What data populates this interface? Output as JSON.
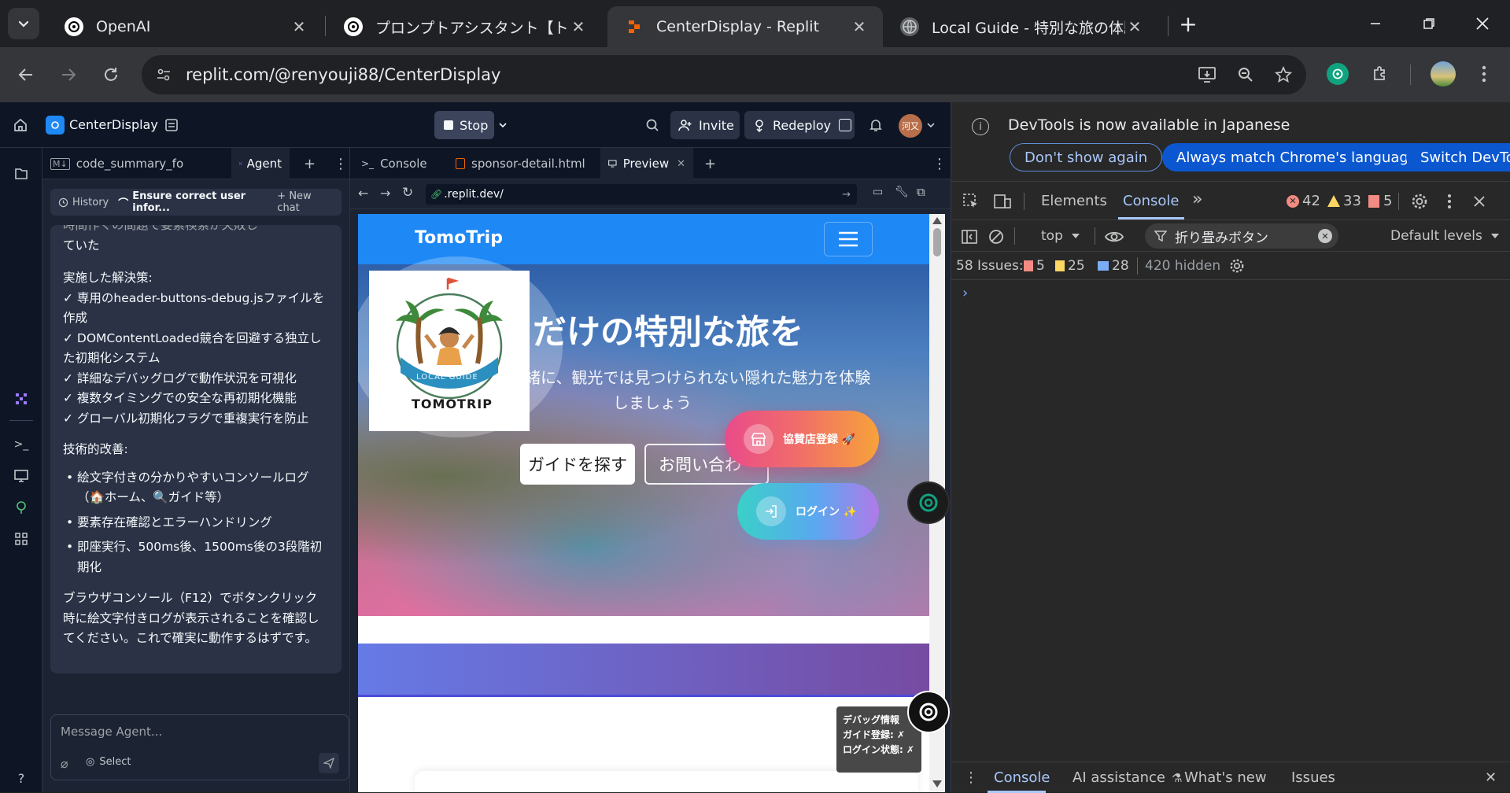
{
  "browser": {
    "tabs": [
      {
        "title": "OpenAI"
      },
      {
        "title": "プロンプトアシスタント【トゥモロープル-"
      },
      {
        "title": "CenterDisplay - Replit"
      },
      {
        "title": "Local Guide - 特別な旅の体験を"
      }
    ],
    "address": "replit.com/@renyouji88/CenterDisplay"
  },
  "replit": {
    "project_name": "CenterDisplay",
    "stop_label": "Stop",
    "invite_label": "Invite",
    "redeploy_label": "Redeploy",
    "avatar_text": "河又",
    "agent_tabs": [
      {
        "label": "code_summary_for_gpt.md"
      },
      {
        "label": "Agent"
      }
    ],
    "history_label": "History",
    "chat_title": "Ensure correct user infor...",
    "new_chat_label": "New chat",
    "message": {
      "partial_top": "時間作くの間題で要素検索か失敗し",
      "line_continue": "ていた",
      "heading1": "実施した解決策:",
      "fixes": [
        "✓ 専用のheader-buttons-debug.jsファイルを作成",
        "✓ DOMContentLoaded競合を回避する独立した初期化システム",
        "✓ 詳細なデバッグログで動作状況を可視化",
        "✓ 複数タイミングでの安全な再初期化機能",
        "✓ グローバル初期化フラグで重複実行を防止"
      ],
      "heading2": "技術的改善:",
      "improvements": [
        "絵文字付きの分かりやすいコンソールログ（🏠ホーム、🔍ガイド等）",
        "要素存在確認とエラーハンドリング",
        "即座実行、500ms後、1500ms後の3段階初期化"
      ],
      "closing": "ブラウザコンソール（F12）でボタンクリック時に絵文字付きログが表示されることを確認してください。これで確実に動作するはずです。"
    },
    "composer_placeholder": "Message Agent...",
    "select_label": "Select",
    "preview_tabs": [
      {
        "label": "Console"
      },
      {
        "label": "sponsor-detail.html"
      },
      {
        "label": "Preview"
      }
    ],
    "preview_url": ".replit.dev/",
    "site": {
      "brand": "TomoTrip",
      "logo_text": "TOMOTRIP",
      "logo_subtext": "LOCAL GUIDE",
      "hero_title": "だけの特別な旅を",
      "hero_subtitle_line1": "緒に、観光では見つけられない隠れた魅力を体験",
      "hero_subtitle_line2": "しましょう",
      "find_guide_button": "ガイドを探す",
      "contact_button": "お問い合わ",
      "sponsor_button": "協賛店登録 🚀",
      "login_button": "ログイン ✨",
      "debug_title": "デバッグ情報",
      "debug_guide": "ガイド登録: ✗",
      "debug_login": "ログイン状態: ✗"
    }
  },
  "devtools": {
    "banner_text": "DevTools is now available in Japanese",
    "banner_buttons": [
      "Don't show again",
      "Always match Chrome's language",
      "Switch DevTo"
    ],
    "tabs": [
      "Elements",
      "Console"
    ],
    "counts": {
      "errors": "42",
      "warnings": "33",
      "issues": "5"
    },
    "context": "top",
    "filter_value": "折り畳みボタン",
    "levels": "Default levels",
    "issues_label": "58 Issues:",
    "issue_counts": {
      "errors": "5",
      "warnings": "25",
      "info": "28"
    },
    "hidden": "420 hidden",
    "bottom_tabs": [
      "Console",
      "AI assistance",
      "What's new",
      "Issues"
    ]
  },
  "colors": {
    "devtools_button": "#0b57d0",
    "replit_bg": "#0e1525",
    "site_header": "#1e88f5",
    "band_start": "#667ae6",
    "band_end": "#764ba2"
  }
}
